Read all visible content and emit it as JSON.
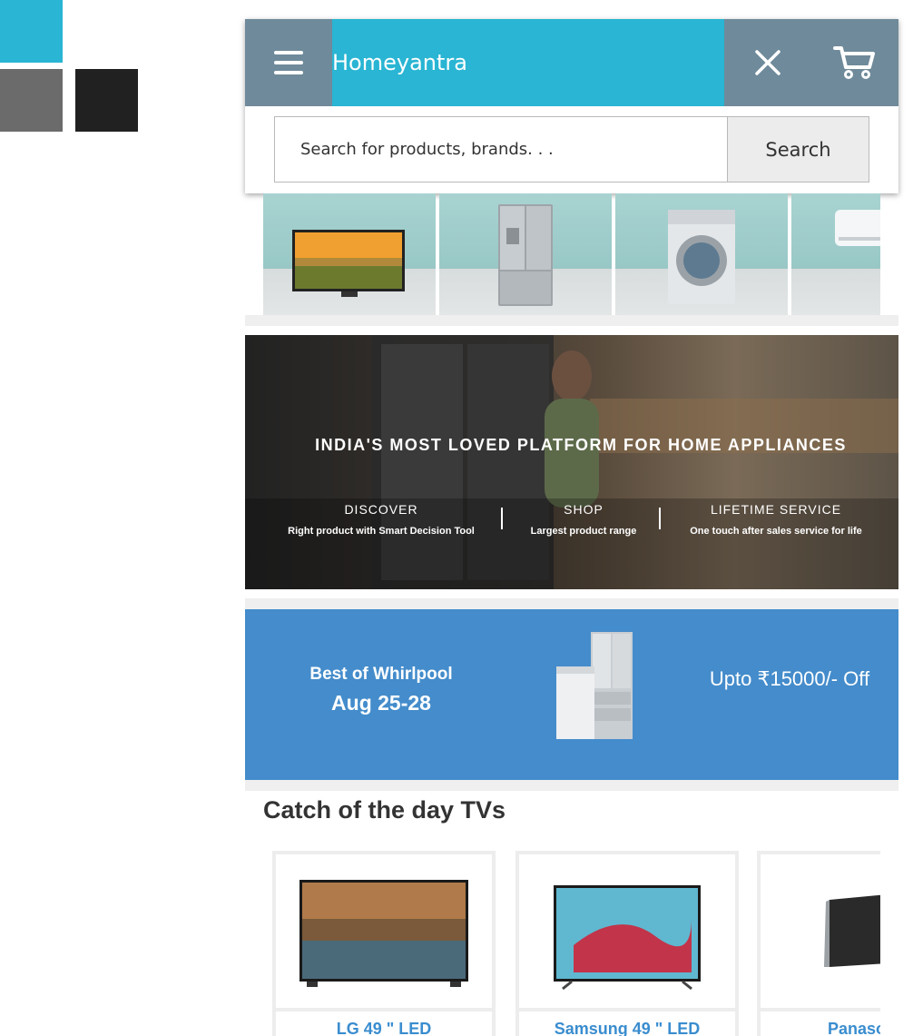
{
  "brand": {
    "name": "Homeyantra"
  },
  "search": {
    "placeholder": "Search for products, brands. . .",
    "button_label": "Search"
  },
  "categories": [
    {
      "name": "led-tv"
    },
    {
      "name": "refrigerator"
    },
    {
      "name": "washing-machine"
    },
    {
      "name": "air-conditioner"
    }
  ],
  "hero": {
    "title": "INDIA'S MOST LOVED PLATFORM FOR HOME APPLIANCES",
    "columns": [
      {
        "heading": "DISCOVER",
        "sub": "Right product with Smart Decision Tool"
      },
      {
        "heading": "SHOP",
        "sub": "Largest product range"
      },
      {
        "heading": "LIFETIME SERVICE",
        "sub": "One touch after sales service for life"
      }
    ]
  },
  "promo": {
    "title": "Best of Whirlpool",
    "dates": "Aug 25-28",
    "offer": "Upto ₹15000/- Off"
  },
  "section": {
    "title": "Catch of the day TVs"
  },
  "products": [
    {
      "name": "LG 49 \" LED"
    },
    {
      "name": "Samsung 49 \" LED"
    },
    {
      "name": "Panasonic"
    }
  ],
  "colors": {
    "accent": "#29b5d3",
    "icon_bar": "#6f8a9a",
    "promo": "#448ccb",
    "product_link": "#3a8dcf"
  },
  "icons": [
    "menu-icon",
    "close-icon",
    "cart-icon"
  ]
}
